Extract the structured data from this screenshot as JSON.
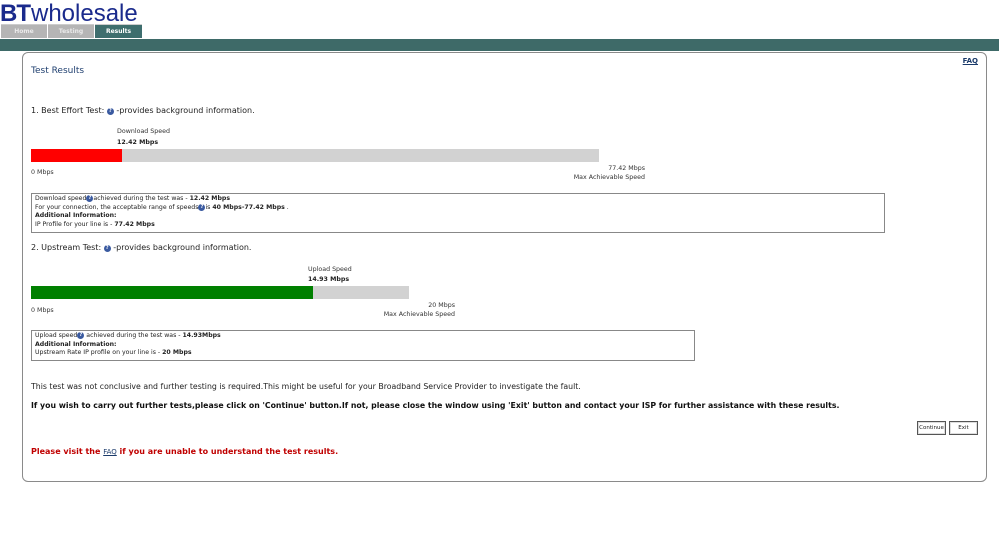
{
  "brand": {
    "logo_bt": "BT",
    "logo_wholesale": "wholesale"
  },
  "tabs": [
    {
      "label": "Home"
    },
    {
      "label": "Testing"
    },
    {
      "label": "Results"
    }
  ],
  "panel": {
    "faq": "FAQ",
    "title": "Test Results"
  },
  "best_effort": {
    "heading_prefix": "1. Best Effort Test:",
    "heading_suffix": "-provides background information.",
    "download_label": "Download Speed",
    "download_value": "12.42 Mbps",
    "zero_label": "0 Mbps",
    "max_value": "77.42 Mbps",
    "max_label": "Max Achievable Speed",
    "fill_fraction": 0.1604,
    "fill_color": "#ff0000",
    "info": {
      "line1_prefix": "Download speed",
      "line1_mid": "achieved during the test was - ",
      "line1_value": "12.42 Mbps",
      "line2_prefix": "For your connection, the acceptable range of speeds",
      "line2_mid": "is ",
      "line2_value": "40 Mbps-77.42 Mbps",
      "line2_end": " .",
      "line3": "Additional Information:",
      "line4_prefix": "IP Profile for your line is - ",
      "line4_value": "77.42 Mbps"
    }
  },
  "upstream": {
    "heading_prefix": "2. Upstream Test:",
    "heading_suffix": "-provides background information.",
    "upload_label": "Upload Speed",
    "upload_value": "14.93 Mbps",
    "zero_label": "0 Mbps",
    "max_value": "20 Mbps",
    "max_label": "Max Achievable Speed",
    "fill_fraction": 0.7465,
    "fill_color": "#008000",
    "info": {
      "line1_prefix": "Upload speed",
      "line1_mid": " achieved during the test was - ",
      "line1_value": "14.93Mbps",
      "line2": "Additional Information:",
      "line3_prefix": "Upstream Rate IP profile on your line is - ",
      "line3_value": "20 Mbps"
    }
  },
  "messages": {
    "not_conclusive": "This test was not conclusive and further testing is required.This might be useful for your Broadband Service Provider to investigate the fault.",
    "continue_instruction": "If you wish to carry out further tests,please click on 'Continue' button.If not, please close the window using 'Exit' button and contact your ISP for further assistance with these results.",
    "visit_prefix": "Please visit the ",
    "visit_faq": "FAQ",
    "visit_suffix": " if you are unable to understand the test results."
  },
  "buttons": {
    "continue": "Continue",
    "exit": "Exit"
  },
  "help_icon": "question-mark",
  "colors": {
    "brand_blue": "#1a2a8c",
    "header_bar": "#3e6a68",
    "notice_red": "#c00000"
  }
}
